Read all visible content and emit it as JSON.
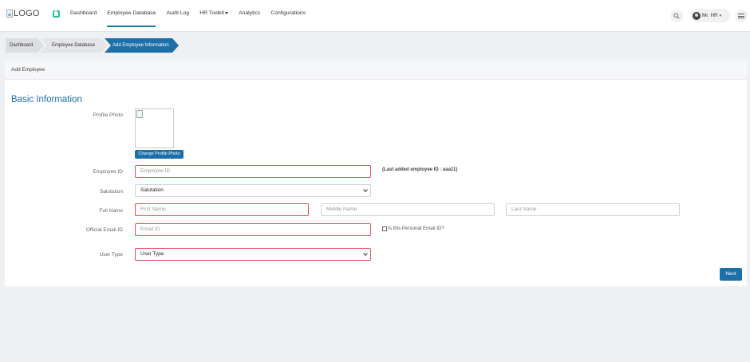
{
  "header": {
    "logo_text": "LOGO",
    "nav": [
      {
        "label": "Dashboard"
      },
      {
        "label": "Employee Database"
      },
      {
        "label": "Audit Log"
      },
      {
        "label": "HR Toolkit"
      },
      {
        "label": "Analytics"
      },
      {
        "label": "Configurations"
      }
    ],
    "user_name": "Mr. HR"
  },
  "breadcrumb": [
    "Dashboard",
    "Employee Database",
    "Add Employee Information"
  ],
  "page": {
    "strip_title": "Add Employee",
    "section_title": "Basic Information"
  },
  "form": {
    "profile_photo_label": "Profile Photo",
    "change_photo_button": "Change Profile Photo",
    "employee_id_label": "Employee ID",
    "employee_id_placeholder": "Employee ID",
    "last_added_hint": "(Last added employee ID : aaa11)",
    "salutation_label": "Salutation",
    "salutation_value": "Salutation",
    "full_name_label": "Full Name",
    "first_name_placeholder": "First Name",
    "middle_name_placeholder": "Middle Name",
    "last_name_placeholder": "Last Name",
    "official_email_label": "Official Email ID",
    "email_placeholder": "Email ID",
    "personal_email_checkbox_label": "Is this Personal Email ID?",
    "user_type_label": "User Type",
    "user_type_value": "User Type",
    "next_button": "Next"
  },
  "colors": {
    "accent": "#1c6fa9",
    "error_border": "#e0505a",
    "home_icon": "#2fc08a"
  },
  "icons": [
    "home-icon",
    "search-icon",
    "avatar",
    "chevron-down-icon",
    "hamburger-menu-icon",
    "broken-image-icon"
  ]
}
